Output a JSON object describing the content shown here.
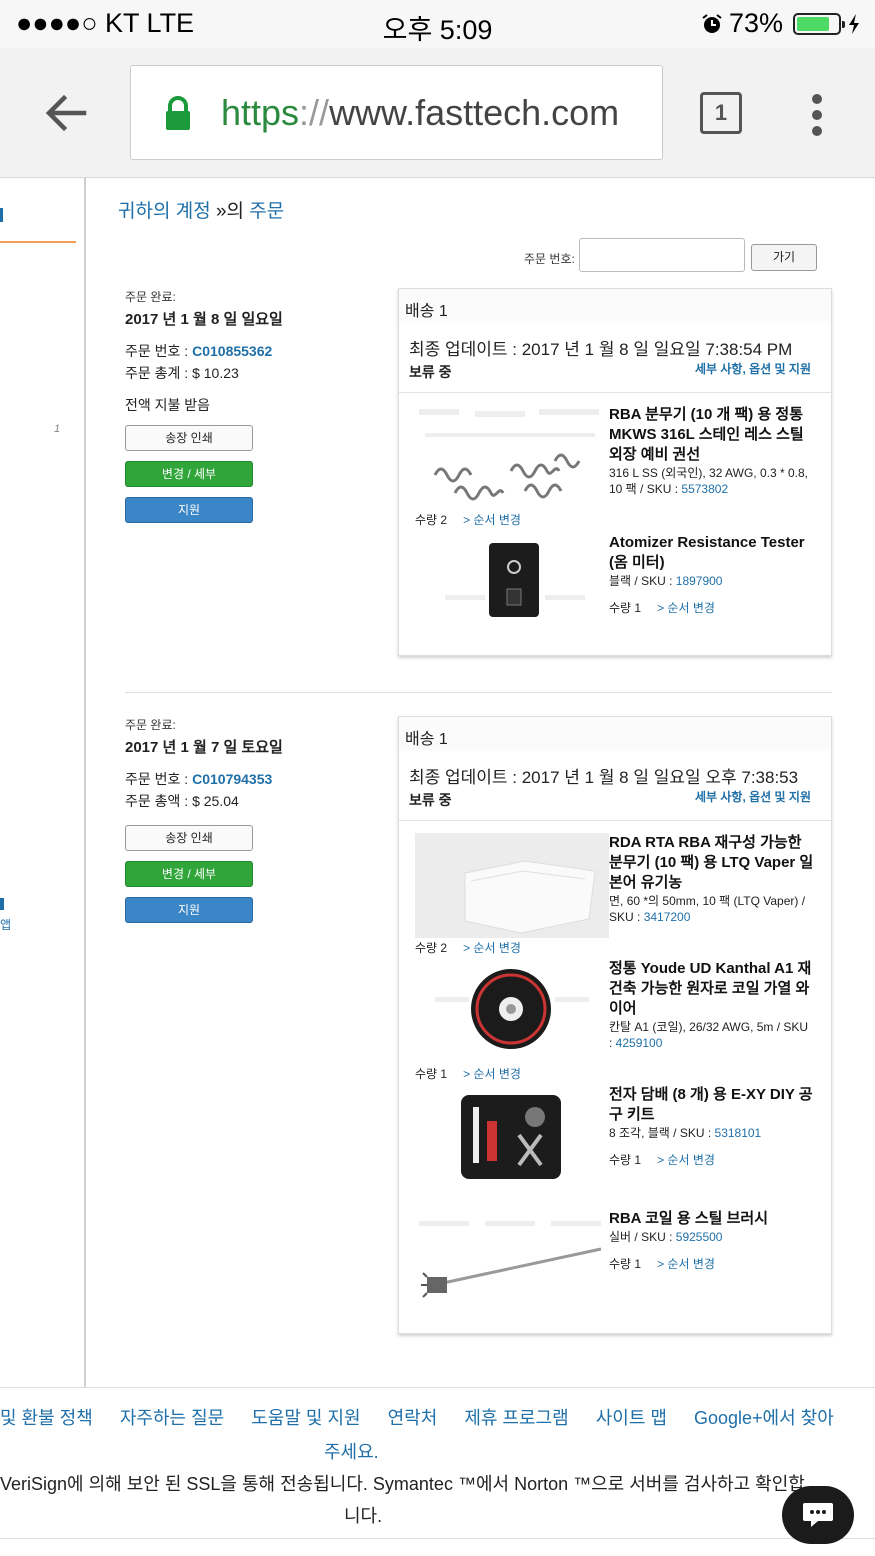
{
  "status": {
    "carrier": "●●●●○ KT   LTE",
    "time": "오후 5:09",
    "battery": "73%"
  },
  "browser": {
    "url_scheme": "https",
    "url_sep": "://",
    "url_host": "www.fasttech.com",
    "tab_count": "1"
  },
  "breadcrumb": {
    "account": "귀하의 계정",
    "sep": " »의 ",
    "orders": "주문"
  },
  "order_search": {
    "label": "주문 번호:",
    "go": "가기"
  },
  "orders": [
    {
      "label": "주문 완료:",
      "date": "2017 년 1 월 8 일 일요일",
      "no_label": "주문 번호 : ",
      "no": "C010855362",
      "total": "주문 총계 : $ 10.23",
      "paid": "전액 지불 받음",
      "buttons": {
        "print": "송장 인쇄",
        "change": "변경 / 세부",
        "support": "지원"
      },
      "shipment": {
        "title": "배송 1",
        "updated": "최종 업데이트 : 2017 년 1 월 8 일 일요일 7:38:54 PM",
        "status": "보류 중",
        "details": "세부 사항, 옵션 및 지원",
        "items": [
          {
            "name": "RBA 분무기 (10 개 팩) 용 정통 MKWS 316L 스테인 레스 스틸 외장 예비 권선",
            "sub": "316 L SS (외국인), 32 AWG, 0.3 * 0.8, 10 팩 / SKU : ",
            "sku": "5573802",
            "qty": "수량 2",
            "reorder": "> 순서 변경"
          },
          {
            "name": "Atomizer Resistance Tester (옴 미터)",
            "sub": "블랙 / SKU : ",
            "sku": "1897900",
            "qty": "수량 1",
            "reorder": "> 순서 변경"
          }
        ]
      }
    },
    {
      "label": "주문 완료:",
      "date": "2017 년 1 월 7 일 토요일",
      "no_label": "주문 번호 : ",
      "no": "C010794353",
      "total": "주문 총액 : $ 25.04",
      "buttons": {
        "print": "송장 인쇄",
        "change": "변경 / 세부",
        "support": "지원"
      },
      "shipment": {
        "title": "배송 1",
        "updated": "최종 업데이트 : 2017 년 1 월 8 일 일요일 오후 7:38:53",
        "status": "보류 중",
        "details": "세부 사항, 옵션 및 지원",
        "items": [
          {
            "name": "RDA RTA RBA 재구성 가능한 분무기 (10 팩) 용 LTQ Vaper 일본어 유기농",
            "sub": "면, 60 *의 50mm, 10 팩 (LTQ Vaper) / SKU : ",
            "sku": "3417200",
            "qty": "수량 2",
            "reorder": "> 순서 변경"
          },
          {
            "name": "정통 Youde UD Kanthal A1 재건축 가능한 원자로 코일 가열 와이어",
            "sub": "칸탈 A1 (코일), 26/32 AWG, 5m / SKU : ",
            "sku": "4259100",
            "qty": "수량 1",
            "reorder": "> 순서 변경"
          },
          {
            "name": "전자 담배 (8 개) 용 E-XY DIY 공구 키트",
            "sub": "8 조각, 블랙 / SKU : ",
            "sku": "5318101",
            "qty": "수량 1",
            "reorder": "> 순서 변경"
          },
          {
            "name": "RBA 코일 용 스틸 브러시",
            "sub": "실버 / SKU : ",
            "sku": "5925500",
            "qty": "수량 1",
            "reorder": "> 순서 변경"
          }
        ]
      }
    }
  ],
  "left": {
    "app": "앱",
    "italic_one": "1"
  },
  "footer": {
    "links": [
      "및 환불 정책",
      "자주하는 질문",
      "도움말 및 지원",
      "연락처",
      "제휴 프로그램",
      "사이트 맵",
      "Google+에서 찾아"
    ],
    "links_tail": "주세요.",
    "ssl": "VeriSign에 의해 보안 된 SSL을 통해 전송됩니다. Symantec ™에서 Norton ™으로 서버를 검사하고 확인합",
    "ssl_tail": "니다."
  }
}
